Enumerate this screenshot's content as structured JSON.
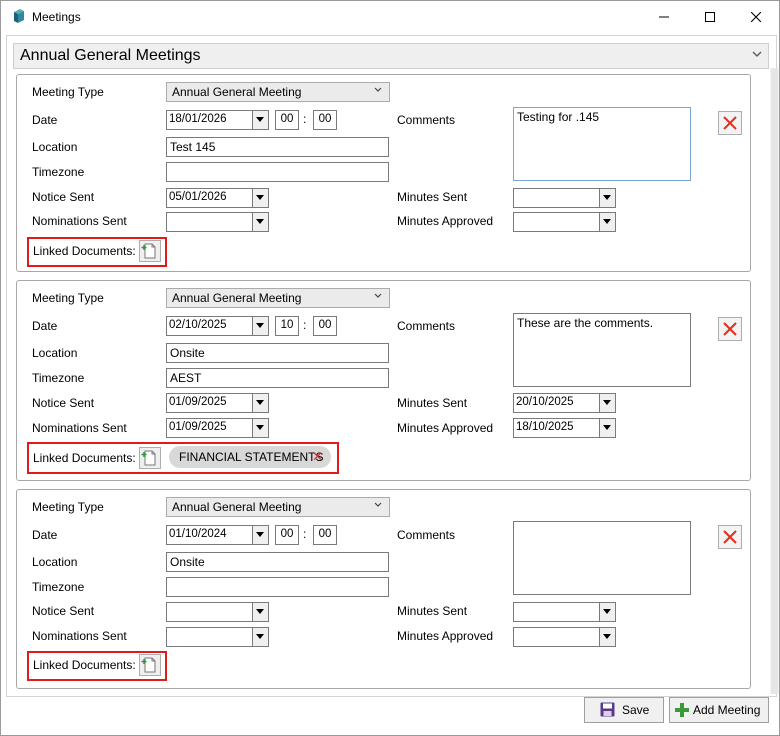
{
  "window": {
    "title": "Meetings"
  },
  "header": {
    "title": "Annual General Meetings"
  },
  "labels": {
    "meeting_type": "Meeting Type",
    "date": "Date",
    "location": "Location",
    "timezone": "Timezone",
    "notice_sent": "Notice Sent",
    "nominations_sent": "Nominations Sent",
    "comments": "Comments",
    "minutes_sent": "Minutes Sent",
    "minutes_approved": "Minutes Approved",
    "linked_documents": "Linked Documents:",
    "time_separator": ":"
  },
  "meetings": [
    {
      "meeting_type": "Annual General Meeting",
      "date": "18/01/2026",
      "hour": "00",
      "minute": "00",
      "location": "Test 145",
      "timezone": "",
      "notice_sent": "05/01/2026",
      "nominations_sent": "",
      "comments": "Testing for .145",
      "minutes_sent": "",
      "minutes_approved": "",
      "documents": []
    },
    {
      "meeting_type": "Annual General Meeting",
      "date": "02/10/2025",
      "hour": "10",
      "minute": "00",
      "location": "Onsite",
      "timezone": "AEST",
      "notice_sent": "01/09/2025",
      "nominations_sent": "01/09/2025",
      "comments": "These are the comments.",
      "minutes_sent": "20/10/2025",
      "minutes_approved": "18/10/2025",
      "documents": [
        "FINANCIAL STATEMENTS"
      ]
    },
    {
      "meeting_type": "Annual General Meeting",
      "date": "01/10/2024",
      "hour": "00",
      "minute": "00",
      "location": "Onsite",
      "timezone": "",
      "notice_sent": "",
      "nominations_sent": "",
      "comments": "",
      "minutes_sent": "",
      "minutes_approved": "",
      "documents": []
    }
  ],
  "footer": {
    "save_label": "Save",
    "add_meeting_label": "Add Meeting"
  },
  "colors": {
    "highlight": "#e01b1b",
    "delete": "#e0301e",
    "add": "#3a9a3a",
    "save": "#5b3a8e"
  },
  "icons": {
    "app": "app-icon",
    "minimize": "minimize-icon",
    "maximize": "maximize-icon",
    "close": "close-icon",
    "delete": "delete-x-icon",
    "document": "document-icon",
    "save": "floppy-disk-icon",
    "add": "plus-icon"
  }
}
